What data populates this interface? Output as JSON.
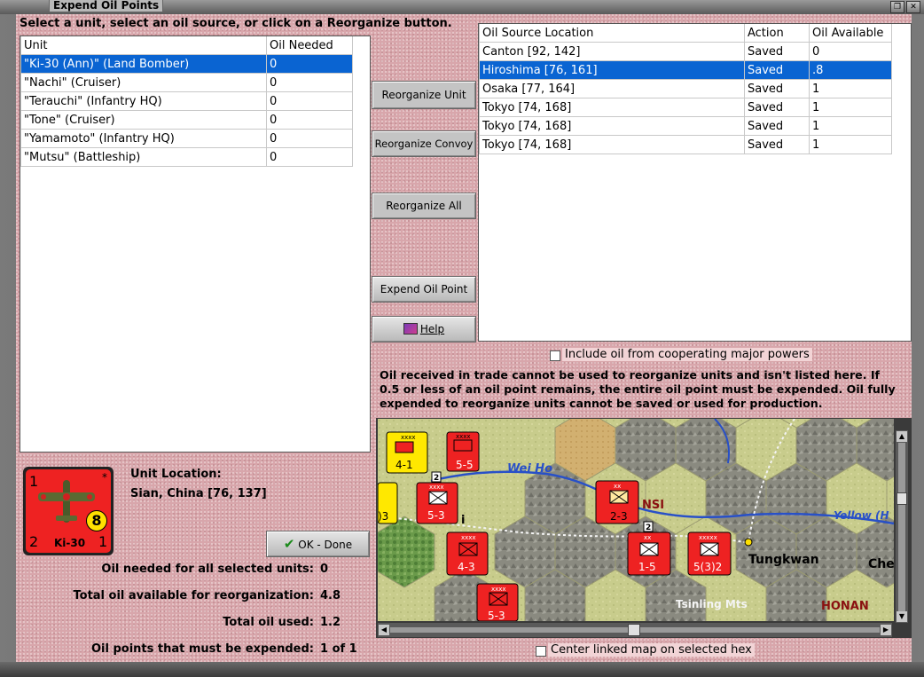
{
  "window": {
    "title": "Expend Oil Points",
    "close_glyph": "✕",
    "restore_glyph": "❐"
  },
  "instructions": "Select a unit, select an oil source, or click on a Reorganize button.",
  "units_table": {
    "headers": [
      "Unit",
      "Oil Needed"
    ],
    "rows": [
      {
        "unit": "\"Ki-30 (Ann)\" (Land Bomber)",
        "oil": "0",
        "selected": true
      },
      {
        "unit": "\"Nachi\" (Cruiser)",
        "oil": "0"
      },
      {
        "unit": "\"Terauchi\" (Infantry HQ)",
        "oil": "0"
      },
      {
        "unit": "\"Tone\" (Cruiser)",
        "oil": "0"
      },
      {
        "unit": "\"Yamamoto\" (Infantry HQ)",
        "oil": "0"
      },
      {
        "unit": "\"Mutsu\" (Battleship)",
        "oil": "0"
      }
    ]
  },
  "sources_table": {
    "headers": [
      "Oil Source Location",
      "Action",
      "Oil Available"
    ],
    "rows": [
      {
        "loc": "Canton [92, 142]",
        "action": "Saved",
        "avail": "0"
      },
      {
        "loc": "Hiroshima [76, 161]",
        "action": "Saved",
        "avail": ".8",
        "selected": true
      },
      {
        "loc": "Osaka [77, 164]",
        "action": "Saved",
        "avail": "1"
      },
      {
        "loc": "Tokyo [74, 168]",
        "action": "Saved",
        "avail": "1"
      },
      {
        "loc": "Tokyo [74, 168]",
        "action": "Saved",
        "avail": "1"
      },
      {
        "loc": "Tokyo [74, 168]",
        "action": "Saved",
        "avail": "1"
      }
    ]
  },
  "buttons": {
    "reorganize_unit": "Reorganize Unit",
    "reorganize_convoy": "Reorganize Convoy",
    "reorganize_all": "Reorganize All",
    "expend_oil_point": "Expend Oil Point",
    "help": "Help",
    "ok_done": "OK - Done"
  },
  "include_coop_label": "Include oil from cooperating major powers",
  "trade_note": "Oil received in trade cannot be used to reorganize units and isn't listed here.  If 0.5 or less of an oil point remains, the entire oil point must be expended.   Oil fully expended to reorganize units cannot be saved or used for production.",
  "unit_counter": {
    "top_left": "1",
    "top_right": "*",
    "bottom_left": "2",
    "bottom_right": "1",
    "name": "Ki-30",
    "factor": "8",
    "color": "#e22222"
  },
  "unit_location": {
    "label": "Unit Location:",
    "value": "Sian, China [76, 137]"
  },
  "summary": [
    {
      "label": "Oil needed for all selected units:",
      "value": "0"
    },
    {
      "label": "Total oil available for reorganization:",
      "value": "4.8"
    },
    {
      "label": "Total oil used:",
      "value": "1.2"
    },
    {
      "label": "Oil points that must be expended:",
      "value": "1 of 1"
    }
  ],
  "map": {
    "labels": {
      "wei_ho": "Wei Ho",
      "nsi": "NSI",
      "yellow": "Yellow (H",
      "tungkwan": "Tungkwan",
      "che": "Che",
      "tsinling": "Tsinling Mts",
      "honan": "HONAN",
      "i_frag": "i"
    },
    "counters": [
      {
        "text": "4-1",
        "top": "xxxx"
      },
      {
        "text": "5-5",
        "top": "xxxx"
      },
      {
        "text": "5-3",
        "top": "xxxx"
      },
      {
        "text": "2-3",
        "top": "xx"
      },
      {
        "text": "1-5",
        "top": "xx"
      },
      {
        "text": "5(3)2",
        "top": "xxxxx"
      },
      {
        "text": "4-3",
        "top": "xxxx"
      },
      {
        "text": "5-3",
        "top": "xxxx"
      },
      {
        "text": ")3",
        "top": ""
      }
    ],
    "stack_badges": [
      "2",
      "2"
    ]
  },
  "center_map_label": "Center linked map on selected hex"
}
